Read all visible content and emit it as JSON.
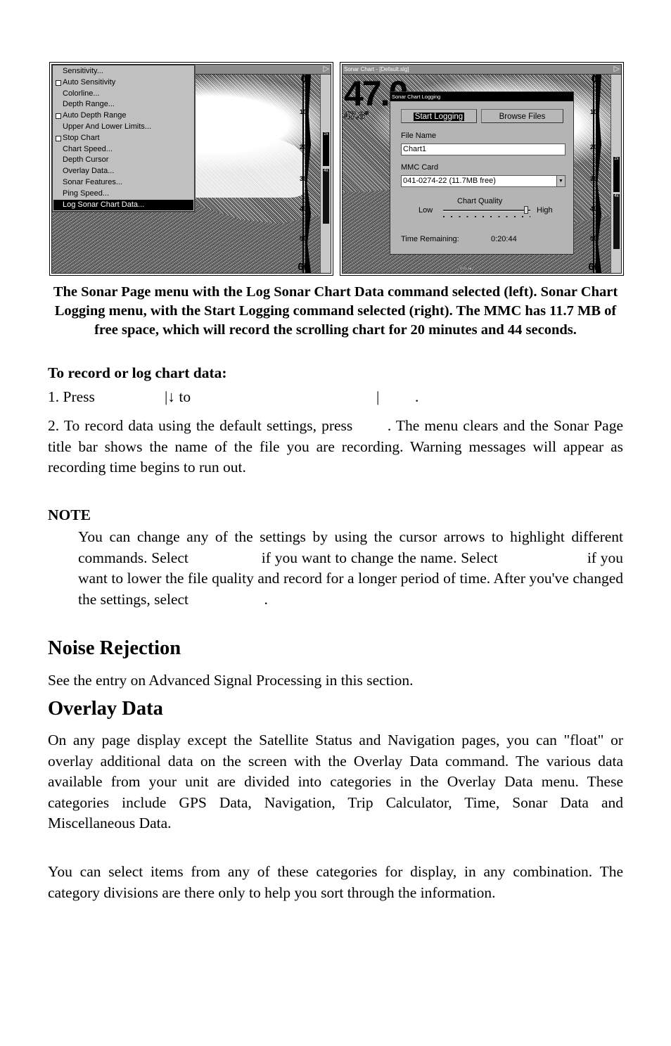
{
  "left_screenshot": {
    "menu_items": [
      {
        "label": "Sensitivity...",
        "checkbox": false,
        "selected": false
      },
      {
        "label": "Auto Sensitivity",
        "checkbox": true,
        "selected": false
      },
      {
        "label": "Colorline...",
        "checkbox": false,
        "selected": false
      },
      {
        "label": "Depth Range...",
        "checkbox": false,
        "selected": false
      },
      {
        "label": "Auto Depth Range",
        "checkbox": true,
        "selected": false
      },
      {
        "label": "Upper And Lower Limits...",
        "checkbox": false,
        "selected": false
      },
      {
        "label": "Stop Chart",
        "checkbox": true,
        "selected": false
      },
      {
        "label": "Chart Speed...",
        "checkbox": false,
        "selected": false
      },
      {
        "label": "Depth Cursor",
        "checkbox": false,
        "selected": false
      },
      {
        "label": "Overlay Data...",
        "checkbox": false,
        "selected": false
      },
      {
        "label": "Sonar Features...",
        "checkbox": false,
        "selected": false
      },
      {
        "label": "Ping Speed...",
        "checkbox": false,
        "selected": false
      },
      {
        "label": "Log Sonar Chart Data...",
        "checkbox": false,
        "selected": true
      }
    ],
    "depth_top": "0",
    "depth_bottom": "60",
    "depth_ticks": [
      "10",
      "20",
      "30",
      "40",
      "50"
    ],
    "zoom_labels": [
      "2x",
      "4x"
    ],
    "title_arrow": "▷"
  },
  "right_screenshot": {
    "title": "Sonar Chart - [Default.slg]",
    "title_arrow": "▷",
    "big_depth": "47.0",
    "temperature": "47.8°",
    "frequency": "200kHz",
    "depth_top": "0",
    "depth_bottom": "60",
    "depth_ticks": [
      "10",
      "20",
      "30",
      "40",
      "50"
    ],
    "zoom_labels": [
      "2x",
      "4x"
    ],
    "dialog": {
      "title": "Sonar Chart Logging",
      "start_button": "Start Logging",
      "browse_button": "Browse Files",
      "file_name_label": "File Name",
      "file_name_value": "Chart1",
      "mmc_label": "MMC Card",
      "mmc_value": "041-0274-22 (11.7MB free)",
      "quality_title": "Chart Quality",
      "quality_low": "Low",
      "quality_high": "High",
      "quality_level_fraction": 0.95,
      "time_label": "Time Remaining:",
      "time_value": "0:20:44"
    }
  },
  "caption": "The Sonar Page menu with the Log Sonar Chart Data command selected (left). Sonar Chart Logging menu, with the Start Logging command selected (right). The MMC has 11.7 MB of free space, which will record the scrolling chart for 20 minutes and 44 seconds.",
  "procedure": {
    "heading": "To record or log chart data:",
    "step1_a": "1. Press",
    "step1_b": "|↓ to",
    "step1_c": "|",
    "step1_d": ".",
    "step2": "2. To record data using the default settings, press       . The menu clears and the Sonar Page title bar shows the name of the file you are recording. Warning messages will appear as recording time begins to run out."
  },
  "note": {
    "heading": "NOTE",
    "body": "You can change any of the settings by using the cursor arrows to highlight different commands. Select                  if you want to change the name. Select                      if you want to lower the file quality and record for a longer period of time. After you've changed the settings, select                    ."
  },
  "noise_rejection": {
    "heading": "Noise Rejection",
    "body": "See the entry on Advanced Signal Processing in this section."
  },
  "overlay_data": {
    "heading": "Overlay Data",
    "para1": "On any page display except the Satellite Status and Navigation pages, you can \"float\" or overlay additional data on the screen with the Overlay Data command. The various data available from your unit are divided into categories in the Overlay Data menu. These categories include GPS Data, Navigation, Trip Calculator, Time, Sonar Data and Miscellaneous Data.",
    "para2": "You can select items from any of these categories for display, in any combination. The category divisions are there only to help you sort through the information."
  }
}
